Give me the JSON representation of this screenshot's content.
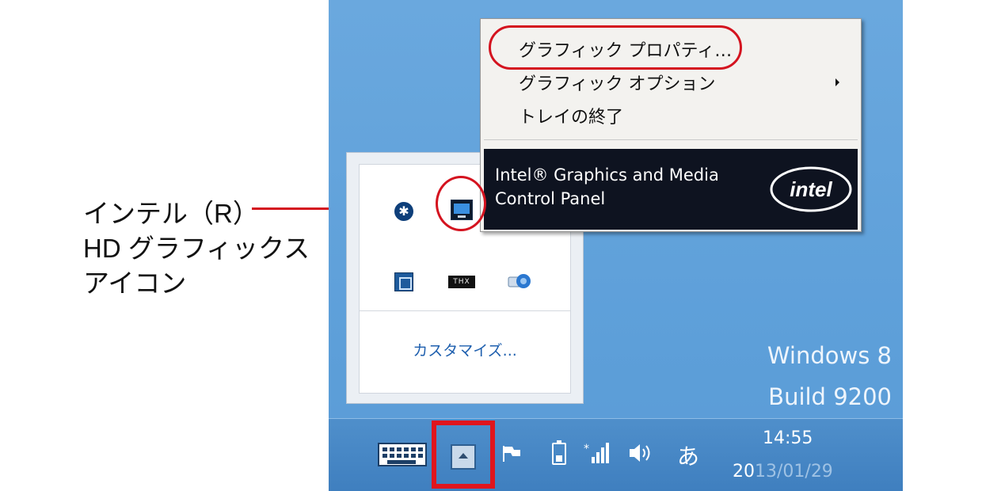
{
  "callout": {
    "line1": "インテル（R）",
    "line2": "HD グラフィックス",
    "line3": "アイコン"
  },
  "desktop": {
    "watermark_line1": "Windows 8",
    "watermark_line2": "Build 9200"
  },
  "context_menu": {
    "items": [
      {
        "label": "グラフィック プロパティ…"
      },
      {
        "label": "グラフィック オプション"
      },
      {
        "label": "トレイの終了"
      }
    ],
    "banner_line1": "Intel® Graphics and Media",
    "banner_line2": "Control Panel",
    "logo_text": "intel"
  },
  "tray_popup": {
    "customize_label": "カスタマイズ...",
    "thx_label": "THX"
  },
  "taskbar": {
    "ime_label": "あ",
    "time": "14:55",
    "date_visible": "20",
    "date_obscured": "13/01/29"
  },
  "colors": {
    "callout_red": "#d4131f",
    "desktop_blue": "#5d9fd9",
    "taskbar_blue": "#4585c4"
  }
}
